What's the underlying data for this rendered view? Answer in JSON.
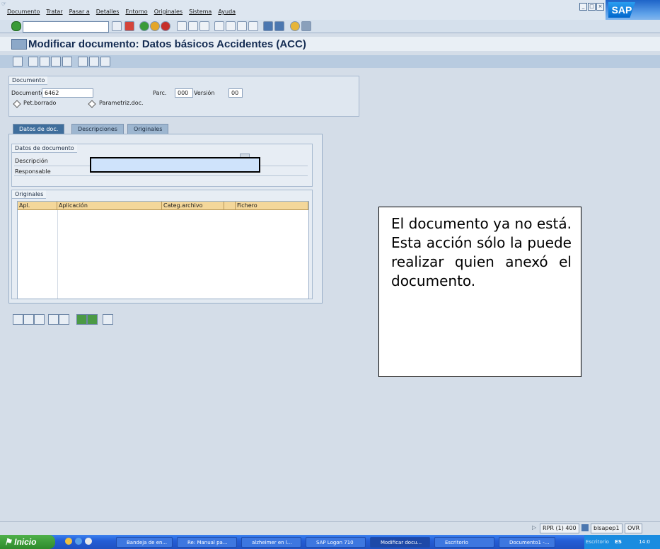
{
  "menu": [
    "Documento",
    "Tratar",
    "Pasar a",
    "Detalles",
    "Entorno",
    "Originales",
    "Sistema",
    "Ayuda"
  ],
  "brand": "SAP",
  "title": "Modificar documento: Datos básicos Accidentes (ACC)",
  "doc": {
    "group_title": "Documento",
    "documento_label": "Documento",
    "documento_value": "6462",
    "parc_label": "Parc.",
    "parc_value": "000",
    "version_label": "Versión",
    "version_value": "00",
    "pet_borrado": "Pet.borrado",
    "parametriz": "Parametriz.doc."
  },
  "tabs": [
    {
      "label": "Datos de doc.",
      "active": true
    },
    {
      "label": "Descripciones",
      "active": false
    },
    {
      "label": "Originales",
      "active": false
    }
  ],
  "datos": {
    "group_title": "Datos de documento",
    "descripcion_label": "Descripción",
    "responsable_label": "Responsable"
  },
  "originales": {
    "group_title": "Originales",
    "columns": [
      "Apl.",
      "Aplicación",
      "Categ.archivo",
      "",
      "Fichero"
    ]
  },
  "callout": "El documento ya no está. Esta acción sólo la puede realizar quien anexó el documento.",
  "status": {
    "system": "RPR (1) 400",
    "server": "blsapep1",
    "mode": "OVR"
  },
  "taskbar": {
    "start": "Inicio",
    "tasks": [
      "Bandeja de en...",
      "Re: Manual pa...",
      "alzheimer en l...",
      "SAP Logon 710",
      "Modificar docu...",
      "Escritorio",
      "Documento1 -..."
    ],
    "tray_text": "Escritorio",
    "lang": "ES",
    "clock": "14:0"
  }
}
